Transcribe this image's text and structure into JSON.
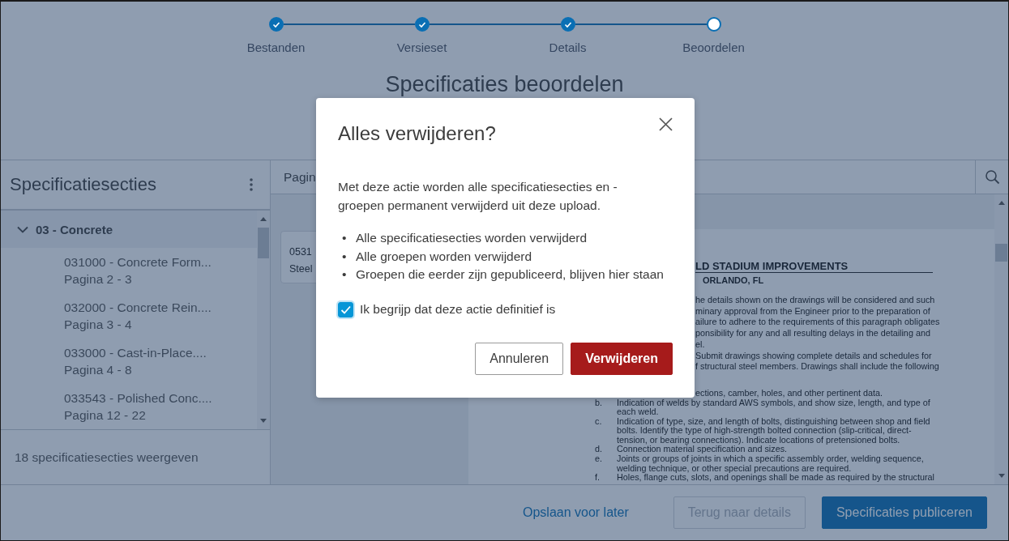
{
  "stepper": [
    {
      "label": "Bestanden",
      "done": true
    },
    {
      "label": "Versieset",
      "done": true
    },
    {
      "label": "Details",
      "done": true
    },
    {
      "label": "Beoordelen",
      "done": false
    }
  ],
  "page_title": "Specificaties beoordelen",
  "sidebar": {
    "title": "Specificatiesecties",
    "groups": [
      {
        "label": "03 - Concrete",
        "expanded": true,
        "children": [
          {
            "title": "031000 - Concrete Form...",
            "pages": "Pagina 2 - 3"
          },
          {
            "title": "032000 - Concrete Rein....",
            "pages": "Pagina 3 - 4"
          },
          {
            "title": "033000 - Cast-in-Place....",
            "pages": "Pagina 4 - 8"
          },
          {
            "title": "033543 - Polished Conc....",
            "pages": "Pagina 12 - 22"
          }
        ]
      }
    ],
    "footer": "18 specificatiesecties weergeven"
  },
  "viewer": {
    "toolbar_label": "Pagin",
    "card": {
      "code": "0531",
      "title": "Steel"
    },
    "document": {
      "heading": "LD STADIUM IMPROVEMENTS",
      "subheading": "ORLANDO, FL",
      "paragraphs": [
        [
          {
            "kind": "cut",
            "text": "he details shown on the drawings will be considered and such"
          },
          {
            "kind": "cut",
            "text": "minary approval from the Engineer prior to the preparation of"
          },
          {
            "kind": "cut",
            "text": "ailure to adhere to the requirements of this paragraph obligates"
          },
          {
            "kind": "cut",
            "text": "ponsibility for any and all resulting delays in the detailing and"
          },
          {
            "kind": "cut",
            "text": "el."
          },
          {
            "kind": "cut",
            "text": "Submit drawings showing complete details and schedules for"
          },
          {
            "kind": "cut",
            "text": "f structural steel members.  Drawings shall include the following"
          }
        ],
        [
          {
            "kind": "cut",
            "text": "ections, camber, holes, and other pertinent data."
          },
          {
            "kind": "item",
            "marker": "b.",
            "text": "Indication of welds by standard AWS symbols, and show size, length, and type of"
          },
          {
            "kind": "cont",
            "text": "each weld."
          },
          {
            "kind": "item",
            "marker": "c.",
            "text": "Indication of type, size, and length of bolts, distinguishing between shop and field"
          },
          {
            "kind": "cont",
            "text": "bolts.  Identify the type of high-strength bolted connection (slip-critical, direct-"
          },
          {
            "kind": "cont",
            "text": "tension, or bearing connections).  Indicate locations of pretensioned bolts."
          },
          {
            "kind": "item",
            "marker": "d.",
            "text": "Connection material specification and sizes."
          },
          {
            "kind": "item",
            "marker": "e.",
            "text": "Joints or groups of joints in which a specific assembly order, welding sequence,"
          },
          {
            "kind": "cont",
            "text": "welding technique, or other special precautions are required."
          },
          {
            "kind": "item",
            "marker": "f.",
            "text": "Holes, flange cuts, slots, and openings shall be made as required by the structural"
          }
        ]
      ]
    }
  },
  "footer_actions": [
    {
      "label": "Opslaan voor later",
      "kind": "link",
      "disabled": false
    },
    {
      "label": "Terug naar details",
      "kind": "secondary",
      "disabled": true
    },
    {
      "label": "Specificaties publiceren",
      "kind": "primary",
      "disabled": false
    }
  ],
  "dialog": {
    "title": "Alles verwijderen?",
    "message": "Met deze actie worden alle specificatiesecties en - groepen permanent verwijderd uit deze upload.",
    "bullets": [
      {
        "marker": "•",
        "text": "Alle specificatiesecties worden verwijderd"
      },
      {
        "marker": "•",
        "text": "Alle groepen worden verwijderd"
      },
      {
        "marker": "•",
        "text": "Groepen die eerder zijn gepubliceerd, blijven hier staan"
      }
    ],
    "checkbox": {
      "label": "Ik begrijp dat deze actie definitief is",
      "checked": true
    },
    "buttons": [
      {
        "label": "Annuleren",
        "kind": "secondary"
      },
      {
        "label": "Verwijderen",
        "kind": "danger"
      }
    ]
  }
}
